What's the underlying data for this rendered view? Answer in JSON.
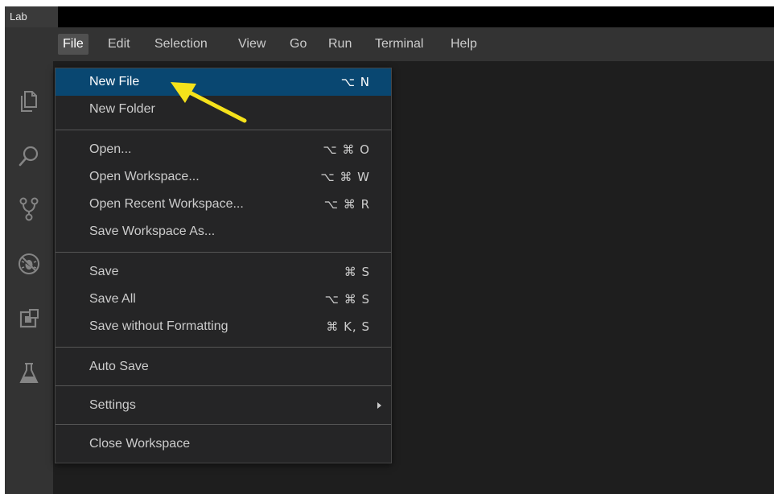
{
  "window": {
    "title": "Lab"
  },
  "menubar": {
    "items": [
      {
        "label": "File"
      },
      {
        "label": "Edit"
      },
      {
        "label": "Selection"
      },
      {
        "label": "View"
      },
      {
        "label": "Go"
      },
      {
        "label": "Run"
      },
      {
        "label": "Terminal"
      },
      {
        "label": "Help"
      }
    ],
    "active": "File"
  },
  "activitybar": {
    "icons": [
      "explorer-icon",
      "search-icon",
      "source-control-icon",
      "debug-icon",
      "extensions-icon",
      "testing-icon"
    ]
  },
  "file_menu": {
    "items": [
      {
        "label": "New File",
        "shortcut": "⌥ N",
        "selected": true
      },
      {
        "label": "New Folder",
        "shortcut": ""
      },
      {
        "label": "Open...",
        "shortcut": "⌥ ⌘ O"
      },
      {
        "label": "Open Workspace...",
        "shortcut": "⌥ ⌘ W"
      },
      {
        "label": "Open Recent Workspace...",
        "shortcut": "⌥ ⌘ R"
      },
      {
        "label": "Save Workspace As...",
        "shortcut": ""
      },
      {
        "label": "Save",
        "shortcut": "⌘ S"
      },
      {
        "label": "Save All",
        "shortcut": "⌥ ⌘ S"
      },
      {
        "label": "Save without Formatting",
        "shortcut": "⌘ K, S"
      },
      {
        "label": "Auto Save",
        "shortcut": ""
      },
      {
        "label": "Settings",
        "shortcut": "",
        "submenu": true
      },
      {
        "label": "Close Workspace",
        "shortcut": ""
      }
    ]
  },
  "colors": {
    "selected_bg": "#094771",
    "menu_bg": "#252526",
    "chrome_bg": "#333333",
    "annotation_arrow": "#f5e21b"
  }
}
